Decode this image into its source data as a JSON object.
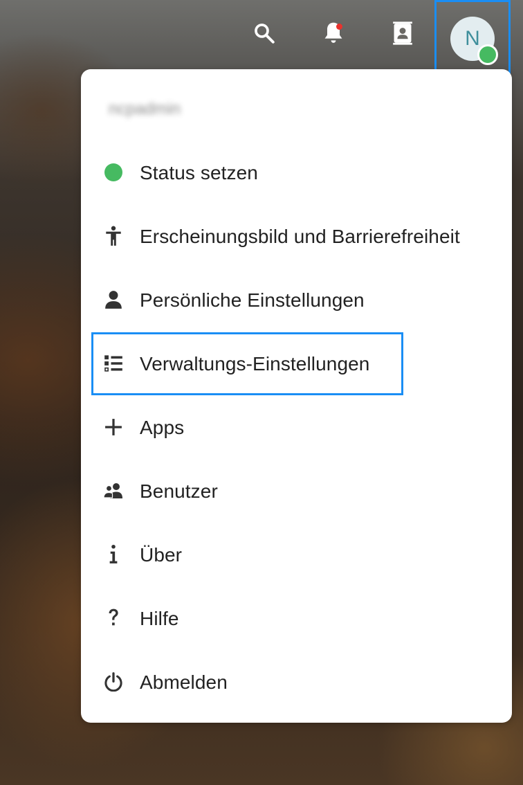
{
  "header": {
    "icons": {
      "search": "search-icon",
      "notifications": "bell-icon",
      "contacts": "contacts-icon"
    },
    "notification_dot_color": "#e9322d",
    "avatar": {
      "initial": "N",
      "status_color": "#46ba61"
    },
    "highlight_color": "#1a8ef5"
  },
  "menu": {
    "username": "ncpadmin",
    "items": [
      {
        "label": "Status setzen",
        "icon": "status-dot-icon"
      },
      {
        "label": "Erscheinungsbild und Barrierefreiheit",
        "icon": "accessibility-icon"
      },
      {
        "label": "Persönliche Einstellungen",
        "icon": "user-icon"
      },
      {
        "label": "Verwaltungs-Einstellungen",
        "icon": "admin-settings-icon",
        "highlighted": true
      },
      {
        "label": "Apps",
        "icon": "plus-icon"
      },
      {
        "label": "Benutzer",
        "icon": "users-icon"
      },
      {
        "label": "Über",
        "icon": "info-icon"
      },
      {
        "label": "Hilfe",
        "icon": "help-icon"
      },
      {
        "label": "Abmelden",
        "icon": "power-icon"
      }
    ]
  }
}
